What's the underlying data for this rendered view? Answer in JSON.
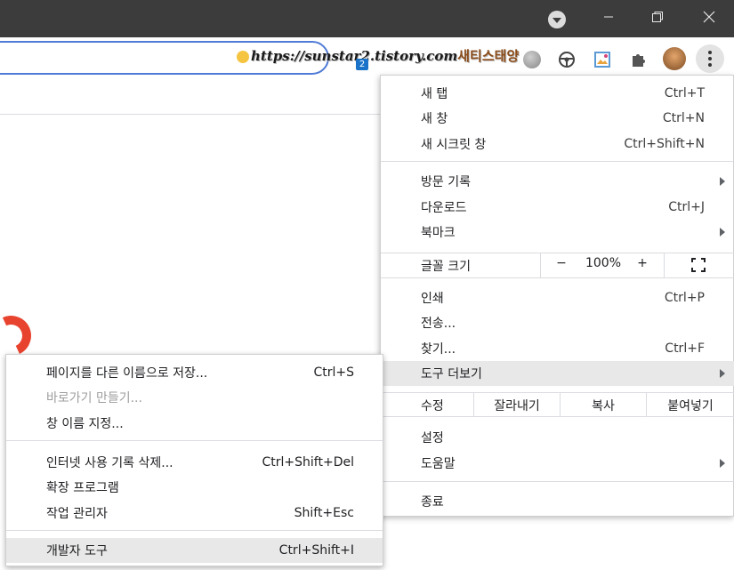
{
  "titlebar": {
    "profile_icon": "profile-dropdown-icon",
    "minimize": "minimize-icon",
    "restore": "restore-icon",
    "close": "close-icon"
  },
  "toolbar": {
    "url_overlay": "https://sunstar2.tistory.com",
    "url_deco": "새티스태양",
    "tab_badge": "2",
    "extensions": [
      "gray-circle-icon",
      "steering-wheel-icon",
      "image-edit-icon",
      "puzzle-icon",
      "avatar"
    ],
    "menu_button_icon": "kebab-menu-icon"
  },
  "menu": {
    "new_tab": {
      "label": "새 탭",
      "shortcut": "Ctrl+T"
    },
    "new_window": {
      "label": "새 창",
      "shortcut": "Ctrl+N"
    },
    "incognito": {
      "label": "새 시크릿 창",
      "shortcut": "Ctrl+Shift+N"
    },
    "history": {
      "label": "방문 기록"
    },
    "downloads": {
      "label": "다운로드",
      "shortcut": "Ctrl+J"
    },
    "bookmarks": {
      "label": "북마크"
    },
    "zoom": {
      "label": "글꼴 크기",
      "minus": "−",
      "value": "100%",
      "plus": "+"
    },
    "print": {
      "label": "인쇄",
      "shortcut": "Ctrl+P"
    },
    "cast": {
      "label": "전송..."
    },
    "find": {
      "label": "찾기...",
      "shortcut": "Ctrl+F"
    },
    "more_tools": {
      "label": "도구 더보기"
    },
    "edit": {
      "label": "수정",
      "cut": "잘라내기",
      "copy": "복사",
      "paste": "붙여넣기"
    },
    "settings": {
      "label": "설정"
    },
    "help": {
      "label": "도움말"
    },
    "exit": {
      "label": "종료"
    }
  },
  "submenu": {
    "save_page": {
      "label": "페이지를 다른 이름으로 저장...",
      "shortcut": "Ctrl+S"
    },
    "create_shortcut": {
      "label": "바로가기 만들기..."
    },
    "name_window": {
      "label": "창 이름 지정..."
    },
    "clear_data": {
      "label": "인터넷 사용 기록 삭제...",
      "shortcut": "Ctrl+Shift+Del"
    },
    "extensions": {
      "label": "확장 프로그램"
    },
    "task_manager": {
      "label": "작업 관리자",
      "shortcut": "Shift+Esc"
    },
    "dev_tools": {
      "label": "개발자 도구",
      "shortcut": "Ctrl+Shift+I"
    }
  }
}
